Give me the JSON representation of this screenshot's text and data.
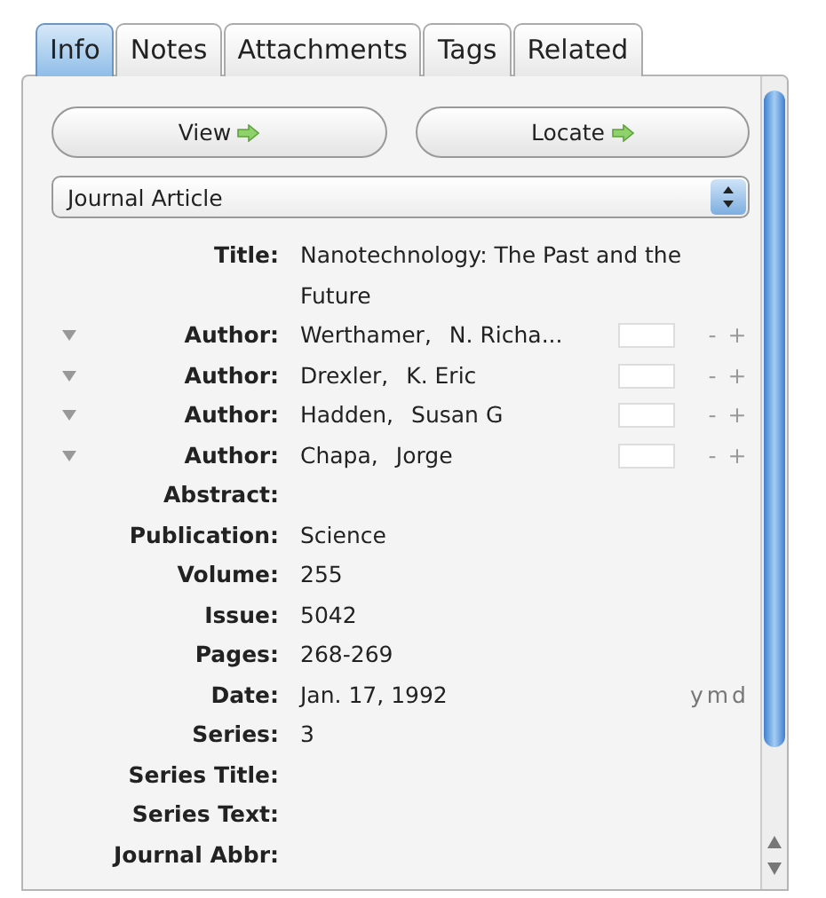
{
  "tabs": [
    {
      "label": "Info",
      "selected": true
    },
    {
      "label": "Notes",
      "selected": false
    },
    {
      "label": "Attachments",
      "selected": false
    },
    {
      "label": "Tags",
      "selected": false
    },
    {
      "label": "Related",
      "selected": false
    }
  ],
  "buttons": [
    {
      "label": "View"
    },
    {
      "label": "Locate"
    }
  ],
  "item_type": {
    "value": "Journal Article"
  },
  "fields": [
    {
      "kind": "text",
      "label": "Title:",
      "value": "Nanotechnology: The Past and the Future"
    },
    {
      "kind": "author",
      "label": "Author:",
      "last": "Werthamer,",
      "first": "N. Richa...",
      "remove": "-",
      "add": "+"
    },
    {
      "kind": "author",
      "label": "Author:",
      "last": "Drexler,",
      "first": "K. Eric",
      "remove": "-",
      "add": "+"
    },
    {
      "kind": "author",
      "label": "Author:",
      "last": "Hadden,",
      "first": "Susan G",
      "remove": "-",
      "add": "+"
    },
    {
      "kind": "author",
      "label": "Author:",
      "last": "Chapa,",
      "first": "Jorge",
      "remove": "-",
      "add": "+"
    },
    {
      "kind": "text",
      "label": "Abstract:"
    },
    {
      "kind": "text",
      "label": "Publication:",
      "value": "Science"
    },
    {
      "kind": "text",
      "label": "Volume:",
      "value": "255"
    },
    {
      "kind": "text",
      "label": "Issue:",
      "value": "5042"
    },
    {
      "kind": "text",
      "label": "Pages:",
      "value": "268-269"
    },
    {
      "kind": "text",
      "label": "Date:",
      "value": "Jan. 17, 1992",
      "hint": "ymd"
    },
    {
      "kind": "text",
      "label": "Series:",
      "value": "3"
    },
    {
      "kind": "text",
      "label": "Series Title:"
    },
    {
      "kind": "text",
      "label": "Series Text:"
    },
    {
      "kind": "text",
      "label": "Journal Abbr:"
    }
  ]
}
